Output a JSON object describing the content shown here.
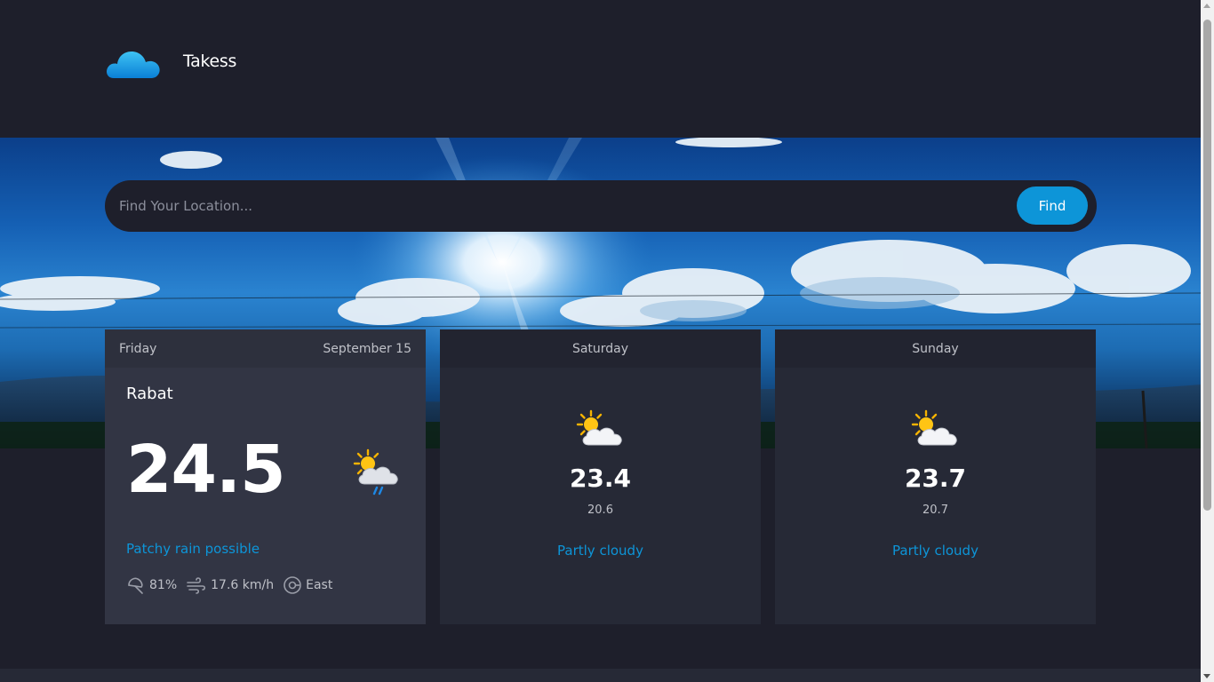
{
  "app": {
    "name": "Takess",
    "logo_icon": "cloud-icon",
    "accent": "#0d95d8"
  },
  "search": {
    "placeholder": "Find Your Location...",
    "value": "",
    "button_label": "Find"
  },
  "today": {
    "day": "Friday",
    "date": "September 15",
    "city": "Rabat",
    "temp": "24.5",
    "icon": "sun-cloud-rain-icon",
    "condition": "Patchy rain possible",
    "humidity": "81%",
    "wind_speed": "17.6 km/h",
    "wind_direction": "East"
  },
  "forecast": [
    {
      "day": "Saturday",
      "icon": "partly-cloudy-icon",
      "max": "23.4",
      "min": "20.6",
      "condition": "Partly cloudy"
    },
    {
      "day": "Sunday",
      "icon": "partly-cloudy-icon",
      "max": "23.7",
      "min": "20.7",
      "condition": "Partly cloudy"
    }
  ]
}
